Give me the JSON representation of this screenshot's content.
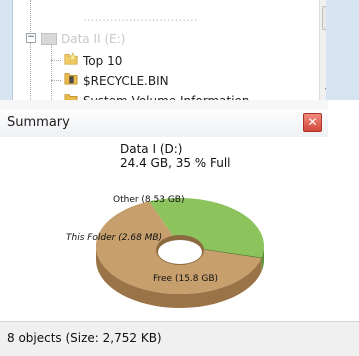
{
  "tree": {
    "items": [
      {
        "label": "..............................",
        "faded": true
      },
      {
        "label": "Data II (E:)",
        "faded": true
      },
      {
        "label": "Top 10",
        "icon": "star-folder-icon"
      },
      {
        "label": "$RECYCLE.BIN",
        "icon": "recycle-folder-icon"
      },
      {
        "label": "System Volume Information",
        "icon": "folder-icon"
      }
    ]
  },
  "summary": {
    "title": "Summary",
    "close_icon": "close-icon",
    "drive_name": "Data I (D:)",
    "drive_usage": "24.4 GB, 35 % Full",
    "slices": {
      "other": "Other (8.53 GB)",
      "this_folder": "This Folder (2.68 MB)",
      "free": "Free (15.8 GB)"
    }
  },
  "colors": {
    "other": "#8cc35c",
    "free": "#c79f6d",
    "close": "#d2473b"
  },
  "chart_data": {
    "type": "pie",
    "title": "",
    "categories": [
      "Other",
      "This Folder",
      "Free"
    ],
    "values": [
      8.53,
      0.00268,
      15.8
    ],
    "units": "GB"
  },
  "status": {
    "text": "8 objects (Size: 2,752 KB)"
  }
}
